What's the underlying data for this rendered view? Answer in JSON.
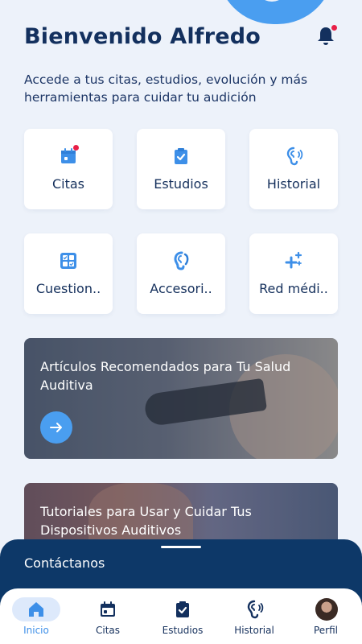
{
  "header": {
    "title": "Bienvenido Alfredo",
    "subtitle": "Accede a tus citas, estudios, evolución y más herramientas para cuidar tu audición",
    "notification_icon": "bell-icon",
    "notification_badge_color": "#e81f47"
  },
  "tiles": [
    {
      "label": "Citas",
      "icon": "calendar-icon"
    },
    {
      "label": "Estudios",
      "icon": "clipboard-check-icon"
    },
    {
      "label": "Historial",
      "icon": "ear-sound-icon"
    },
    {
      "label": "Cuestion..",
      "icon": "checklist-grid-icon"
    },
    {
      "label": "Accesori..",
      "icon": "hearing-aid-icon"
    },
    {
      "label": "Red médi..",
      "icon": "sparkle-plus-icon"
    }
  ],
  "cards": [
    {
      "title": "Artículos Recomendados para Tu Salud Auditiva",
      "action_icon": "arrow-right-icon"
    },
    {
      "title": "Tutoriales para Usar y Cuidar Tus Dispositivos Auditivos"
    }
  ],
  "contact": {
    "label": "Contáctanos"
  },
  "tabbar": {
    "items": [
      {
        "label": "Inicio",
        "icon": "home-icon",
        "active": true
      },
      {
        "label": "Citas",
        "icon": "calendar-icon"
      },
      {
        "label": "Estudios",
        "icon": "clipboard-check-icon"
      },
      {
        "label": "Historial",
        "icon": "ear-sound-icon"
      },
      {
        "label": "Perfil",
        "icon": "avatar"
      }
    ]
  },
  "colors": {
    "accent": "#4a9ef0",
    "primary_text": "#13305e",
    "contact_bar": "#0d3868",
    "active_tab": "#3d8fe8"
  }
}
